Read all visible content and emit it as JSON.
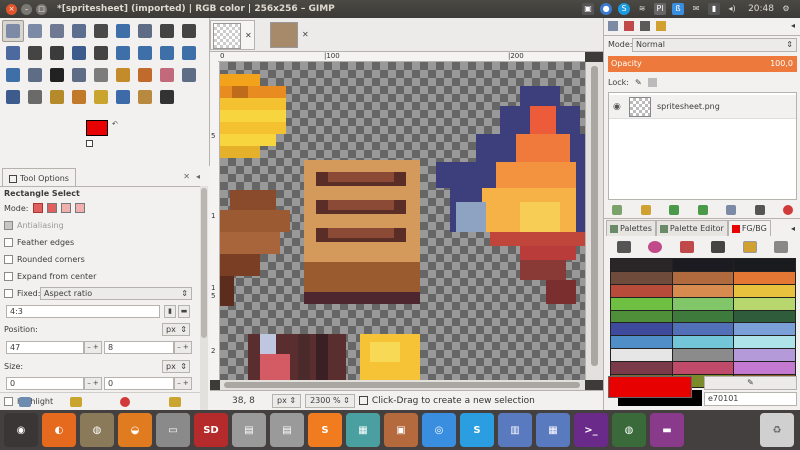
{
  "window": {
    "title": "*[spritesheet] (imported) | RGB color | 256x256 – GIMP",
    "clock": "20:48"
  },
  "toolbox": {
    "tools": [
      {
        "name": "rect-select-icon",
        "color": "#7d8aa6"
      },
      {
        "name": "ellipse-select-icon",
        "color": "#7d8aa6"
      },
      {
        "name": "free-select-icon",
        "color": "#6f7a92"
      },
      {
        "name": "fuzzy-select-icon",
        "color": "#5c6f8f"
      },
      {
        "name": "scissors-select-icon",
        "color": "#4a4a4a"
      },
      {
        "name": "foreground-select-icon",
        "color": "#3e6fa8"
      },
      {
        "name": "color-select-icon",
        "color": "#5e6c86"
      },
      {
        "name": "paths-icon",
        "color": "#444444"
      },
      {
        "name": "color-picker-icon",
        "color": "#444444"
      },
      {
        "name": "zoom-icon",
        "color": "#4c6aa0"
      },
      {
        "name": "measure-icon",
        "color": "#444444"
      },
      {
        "name": "move-icon",
        "color": "#3b3b3b"
      },
      {
        "name": "align-icon",
        "color": "#3d5b8c"
      },
      {
        "name": "crop-icon",
        "color": "#444444"
      },
      {
        "name": "rotate-icon",
        "color": "#3e6fa8"
      },
      {
        "name": "scale-icon",
        "color": "#3e6fa8"
      },
      {
        "name": "shear-icon",
        "color": "#3e6fa8"
      },
      {
        "name": "perspective-icon",
        "color": "#3e6fa8"
      },
      {
        "name": "flip-icon",
        "color": "#3e6fa8"
      },
      {
        "name": "cage-icon",
        "color": "#5e6c86"
      },
      {
        "name": "text-icon",
        "color": "#222222"
      },
      {
        "name": "bucket-fill-icon",
        "color": "#5e6c86"
      },
      {
        "name": "blend-icon",
        "color": "#7c7c7c"
      },
      {
        "name": "pencil-icon",
        "color": "#c48b2a"
      },
      {
        "name": "paintbrush-icon",
        "color": "#c06a2b"
      },
      {
        "name": "eraser-icon",
        "color": "#c26a7c"
      },
      {
        "name": "airbrush-icon",
        "color": "#5e6c86"
      },
      {
        "name": "ink-icon",
        "color": "#3d5b8c"
      },
      {
        "name": "mypaint-brush-icon",
        "color": "#6a6a6a"
      },
      {
        "name": "clone-icon",
        "color": "#b58a2a"
      },
      {
        "name": "heal-icon",
        "color": "#c07a2a"
      },
      {
        "name": "perspective-clone-icon",
        "color": "#c9a530"
      },
      {
        "name": "blur-icon",
        "color": "#3d6aa8"
      },
      {
        "name": "smudge-icon",
        "color": "#b88a40"
      },
      {
        "name": "dodge-burn-icon",
        "color": "#333333"
      }
    ],
    "fg_color": "#e70101",
    "bg_color": "#000000"
  },
  "tool_options": {
    "tab_label": "Tool Options",
    "tool_name": "Rectangle Select",
    "mode_label": "Mode:",
    "antialiasing": "Antialiasing",
    "feather_edges": "Feather edges",
    "rounded_corners": "Rounded corners",
    "expand_from_center": "Expand from center",
    "fixed_label": "Fixed:",
    "fixed_value": "Aspect ratio",
    "ratio_value": "4:3",
    "position_label": "Position:",
    "position_unit": "px",
    "position_x": "47",
    "position_y": "8",
    "size_label": "Size:",
    "size_unit": "px",
    "size_w": "0",
    "size_h": "0",
    "highlight": "Highlight"
  },
  "rulers": {
    "h_labels": [
      "0",
      "|100",
      "|200"
    ],
    "v_labels": [
      "5",
      "1",
      "1 5",
      "2"
    ]
  },
  "statusbar": {
    "coords": "38, 8",
    "unit": "px",
    "zoom": "2300 %",
    "hint": "Click-Drag to create a new selection"
  },
  "layers": {
    "mode_label": "Mode:",
    "mode_value": "Normal",
    "opacity_label": "Opacity",
    "opacity_value": "100,0",
    "lock_label": "Lock:",
    "layer_name": "spritesheet.png"
  },
  "palettes": {
    "tabs": [
      "Palettes",
      "Palette Editor",
      "FG/BG"
    ],
    "hex_value": "e70101",
    "swatches": [
      "#2a2628",
      "#1d1b22",
      "#1a1b1e",
      "#6e4b3a",
      "#b06a3e",
      "#e57734",
      "#b84c3a",
      "#d78b4f",
      "#e8c13f",
      "#6fbf42",
      "#82c66a",
      "#b7d66d",
      "#4f8f3a",
      "#3e7a3c",
      "#2f5d3c",
      "#3e4a9b",
      "#5270b7",
      "#7ba0d8",
      "#4f8ec6",
      "#72c6d8",
      "#aee3ea",
      "#e6e6e6",
      "#8b8b8b",
      "#b49ad8",
      "#7a3a4a",
      "#c04a6a",
      "#c37ad0",
      "#7a6a3a",
      "#7b8a2a",
      "#8a5a2a"
    ]
  },
  "dock": {
    "apps": [
      {
        "name": "ubuntu-icon",
        "glyph": "◉",
        "color": "#3b3636"
      },
      {
        "name": "firefox-icon",
        "glyph": "◐",
        "color": "#e66a1e"
      },
      {
        "name": "gimp-icon",
        "glyph": "◍",
        "color": "#8a7a5a"
      },
      {
        "name": "blender-icon",
        "glyph": "◒",
        "color": "#e07b1f"
      },
      {
        "name": "disk-icon",
        "glyph": "▭",
        "color": "#8a8a8a"
      },
      {
        "name": "sd-card-icon",
        "glyph": "SD",
        "color": "#b52a2a"
      },
      {
        "name": "drive-icon",
        "glyph": "▤",
        "color": "#9a9a9a"
      },
      {
        "name": "drive2-icon",
        "glyph": "▤",
        "color": "#9a9a9a"
      },
      {
        "name": "sublime-icon",
        "glyph": "S",
        "color": "#f07c1f"
      },
      {
        "name": "terminal-icon",
        "glyph": "▦",
        "color": "#4aa0a0"
      },
      {
        "name": "files-icon",
        "glyph": "▣",
        "color": "#b56a3e"
      },
      {
        "name": "chrome-icon",
        "glyph": "◎",
        "color": "#3a8ee0"
      },
      {
        "name": "skype-icon",
        "glyph": "S",
        "color": "#2a9ee0"
      },
      {
        "name": "document-icon",
        "glyph": "▥",
        "color": "#5a7ac0"
      },
      {
        "name": "spreadsheet-icon",
        "glyph": "▦",
        "color": "#5a7ac0"
      },
      {
        "name": "vm-icon",
        "glyph": ">_",
        "color": "#6a2a8a"
      },
      {
        "name": "blend-app-icon",
        "glyph": "◍",
        "color": "#3a6a3a"
      },
      {
        "name": "app-window-icon",
        "glyph": "▬",
        "color": "#8a3a8a"
      },
      {
        "name": "trash-icon",
        "glyph": "♻",
        "color": "#d0d0d0"
      }
    ]
  }
}
